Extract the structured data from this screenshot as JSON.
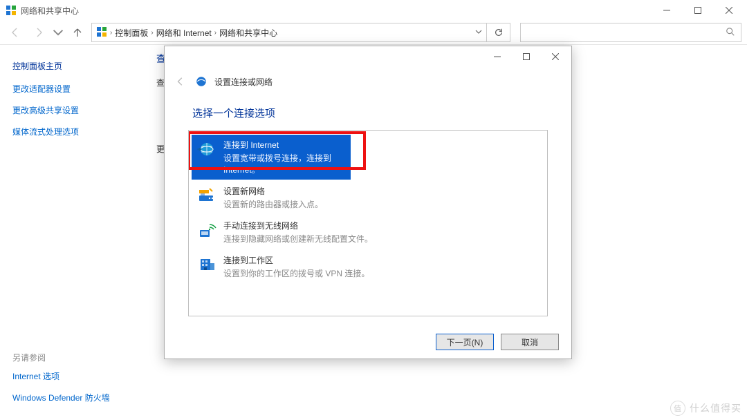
{
  "window": {
    "title": "网络和共享中心",
    "controls": {
      "min": "min",
      "max": "max",
      "close": "close"
    }
  },
  "nav": {
    "crumbs": [
      "控制面板",
      "网络和 Internet",
      "网络和共享中心"
    ]
  },
  "search": {
    "placeholder": ""
  },
  "sidebar": {
    "title": "控制面板主页",
    "links": [
      "更改适配器设置",
      "更改高级共享设置",
      "媒体流式处理选项"
    ],
    "seeAlso": {
      "header": "另请参阅",
      "items": [
        "Internet 选项",
        "Windows Defender 防火墙"
      ]
    }
  },
  "content": {
    "peek1": "查",
    "peek2": "查看",
    "peek3": "更改"
  },
  "dialog": {
    "title": "设置连接或网络",
    "heading": "选择一个连接选项",
    "options": [
      {
        "title": "连接到 Internet",
        "desc": "设置宽带或拨号连接，连接到 Internet。",
        "selected": true
      },
      {
        "title": "设置新网络",
        "desc": "设置新的路由器或接入点。",
        "selected": false
      },
      {
        "title": "手动连接到无线网络",
        "desc": "连接到隐藏网络或创建新无线配置文件。",
        "selected": false
      },
      {
        "title": "连接到工作区",
        "desc": "设置到你的工作区的拨号或 VPN 连接。",
        "selected": false
      }
    ],
    "buttons": {
      "next": "下一页(N)",
      "cancel": "取消"
    }
  },
  "watermark": {
    "brand": "值",
    "text": "什么值得买"
  }
}
